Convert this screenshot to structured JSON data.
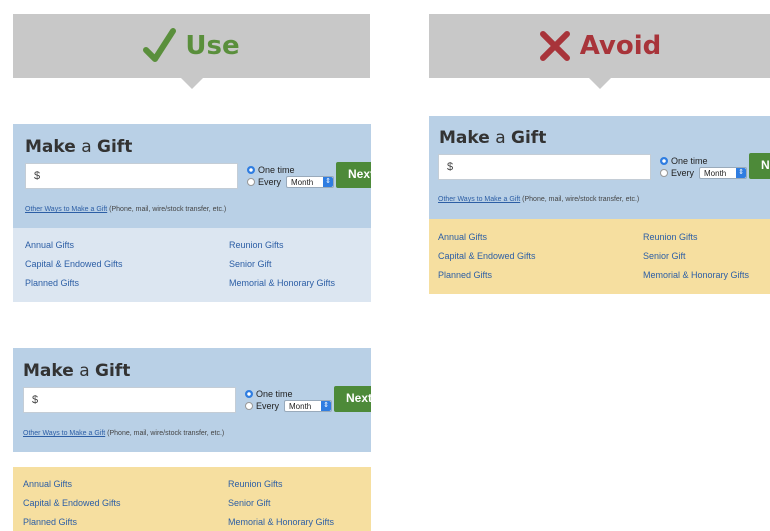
{
  "use_banner": {
    "label": "Use",
    "icon": "checkmark-icon",
    "color": "#5a8f3c"
  },
  "avoid_banner": {
    "label": "Avoid",
    "icon": "x-mark-icon",
    "color": "#a8343a"
  },
  "colors": {
    "banner_bg": "#c8c8c8",
    "form_bg": "#b9d0e6",
    "links_bg_use": "#dce6f1",
    "links_bg_avoid": "#f6dfa0",
    "next_button": "#4d8a39",
    "link_text": "#2c5ea5"
  },
  "gift_form": {
    "title_bold_1": "Make",
    "title_light": "a",
    "title_bold_2": "Gift",
    "amount_placeholder": "$",
    "freq_one_time": "One time",
    "freq_every": "Every",
    "freq_select_value": "Month",
    "next_label": "Next",
    "other_ways_link": "Other Ways to Make a Gift",
    "other_ways_note": " (Phone, mail, wire/stock transfer, etc.)",
    "gift_links": [
      "Annual Gifts",
      "Reunion Gifts",
      "Capital & Endowed Gifts",
      "Senior Gift",
      "Planned Gifts",
      "Memorial & Honorary Gifts"
    ]
  },
  "avoid_form": {
    "next_label": "N"
  }
}
